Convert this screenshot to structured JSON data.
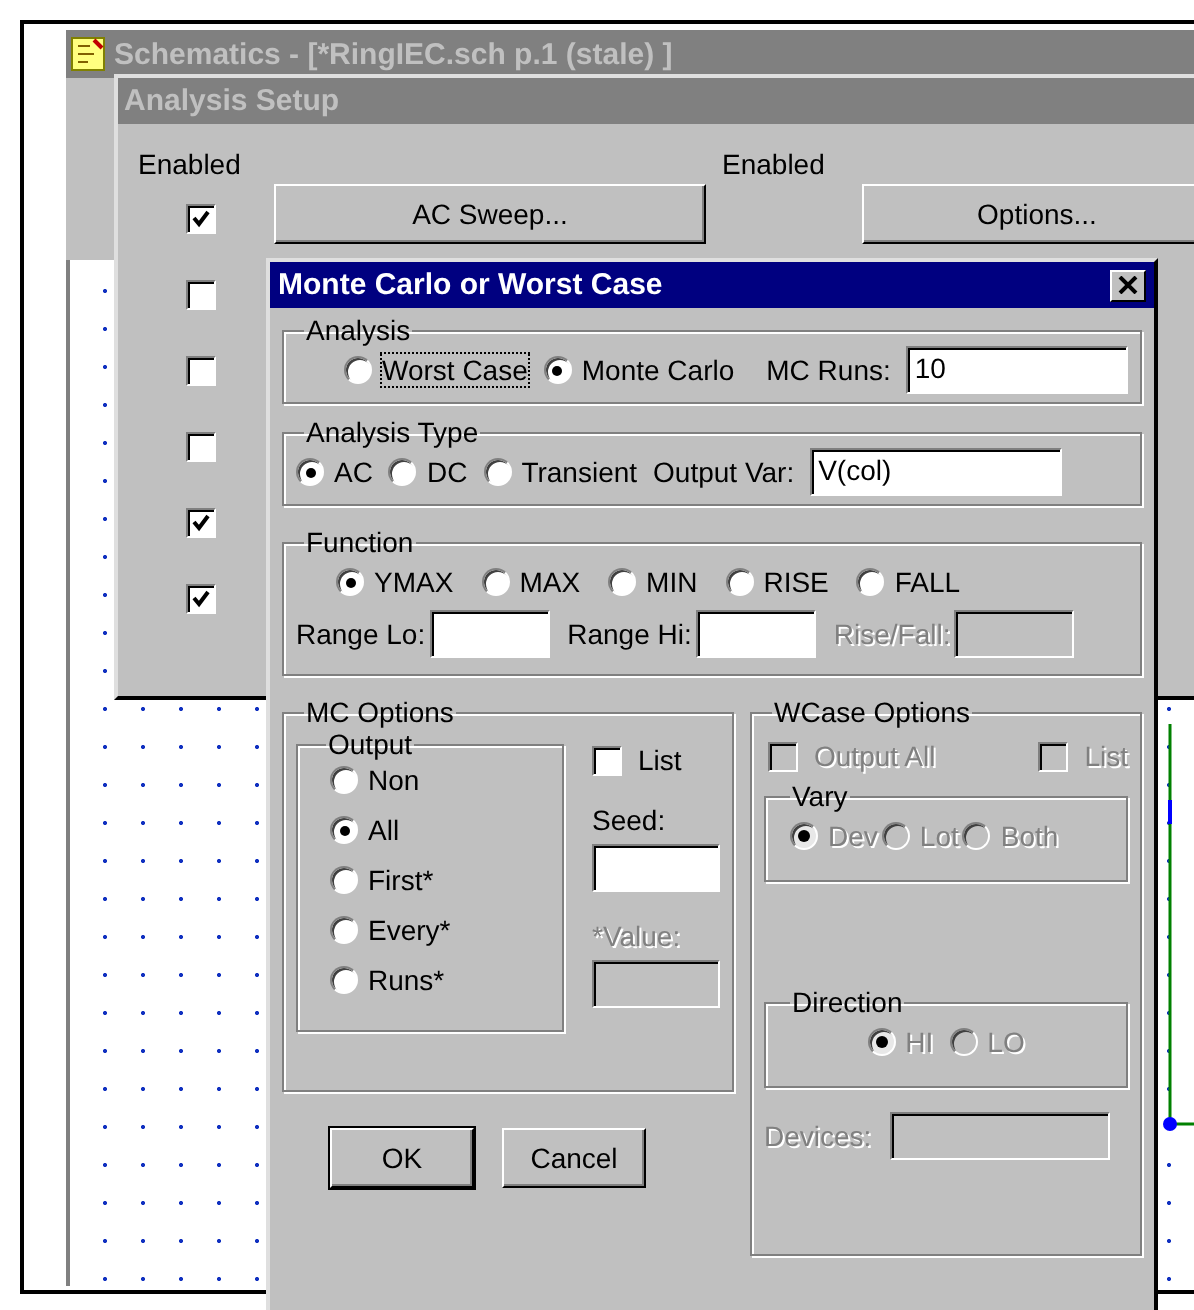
{
  "schematics": {
    "title": "Schematics - [*RingIEC.sch  p.1 (stale) ]"
  },
  "analysis_setup": {
    "title": "Analysis Setup",
    "headers": [
      "Enabled",
      "Enabled"
    ],
    "enabled": [
      {
        "checked": true
      },
      {
        "checked": false
      },
      {
        "checked": false
      },
      {
        "checked": false
      },
      {
        "checked": true
      },
      {
        "checked": true
      }
    ],
    "buttons": [
      "AC Sweep...",
      "Options..."
    ]
  },
  "dialog": {
    "title": "Monte Carlo or Worst Case",
    "analysis": {
      "label": "Analysis",
      "options": [
        {
          "label": "Worst Case",
          "selected": false,
          "focused": true
        },
        {
          "label": "Monte Carlo",
          "selected": true,
          "focused": false
        }
      ],
      "runs_label": "MC Runs:",
      "runs_value": "10"
    },
    "analysis_type": {
      "label": "Analysis Type",
      "options": [
        {
          "label": "AC",
          "selected": true
        },
        {
          "label": "DC",
          "selected": false
        },
        {
          "label": "Transient",
          "selected": false
        }
      ],
      "output_label": "Output Var:",
      "output_value": "V(col)"
    },
    "function": {
      "label": "Function",
      "options": [
        {
          "label": "YMAX",
          "selected": true
        },
        {
          "label": "MAX",
          "selected": false
        },
        {
          "label": "MIN",
          "selected": false
        },
        {
          "label": "RISE",
          "selected": false
        },
        {
          "label": "FALL",
          "selected": false
        }
      ],
      "fields": [
        {
          "label": "Range Lo:",
          "disabled": false
        },
        {
          "label": "Range Hi:",
          "disabled": false
        },
        {
          "label": "Rise/Fall:",
          "disabled": true
        }
      ]
    },
    "mc_options": {
      "label": "MC Options",
      "output": {
        "label": "Output",
        "options": [
          {
            "label": "Non",
            "selected": false
          },
          {
            "label": "All",
            "selected": true
          },
          {
            "label": "First*",
            "selected": false
          },
          {
            "label": "Every*",
            "selected": false
          },
          {
            "label": "Runs*",
            "selected": false
          }
        ]
      },
      "list": {
        "label": "List",
        "checked": false
      },
      "seed": {
        "label": "Seed:",
        "disabled": false
      },
      "value": {
        "label": "*Value:",
        "disabled": true
      }
    },
    "wcase_options": {
      "label": "WCase Options",
      "checks": [
        {
          "label": "Output All",
          "checked": false,
          "disabled": true
        },
        {
          "label": "List",
          "checked": false,
          "disabled": true
        }
      ],
      "vary": {
        "label": "Vary",
        "options": [
          {
            "label": "Dev",
            "selected": true,
            "disabled": true
          },
          {
            "label": "Lot",
            "selected": false,
            "disabled": true
          },
          {
            "label": "Both",
            "selected": false,
            "disabled": true
          }
        ]
      },
      "direction": {
        "label": "Direction",
        "options": [
          {
            "label": "HI",
            "selected": true,
            "disabled": true
          },
          {
            "label": "LO",
            "selected": false,
            "disabled": true
          }
        ]
      },
      "devices": {
        "label": "Devices:",
        "disabled": true
      }
    },
    "buttons": [
      {
        "label": "OK",
        "default": true
      },
      {
        "label": "Cancel",
        "default": false
      }
    ]
  }
}
